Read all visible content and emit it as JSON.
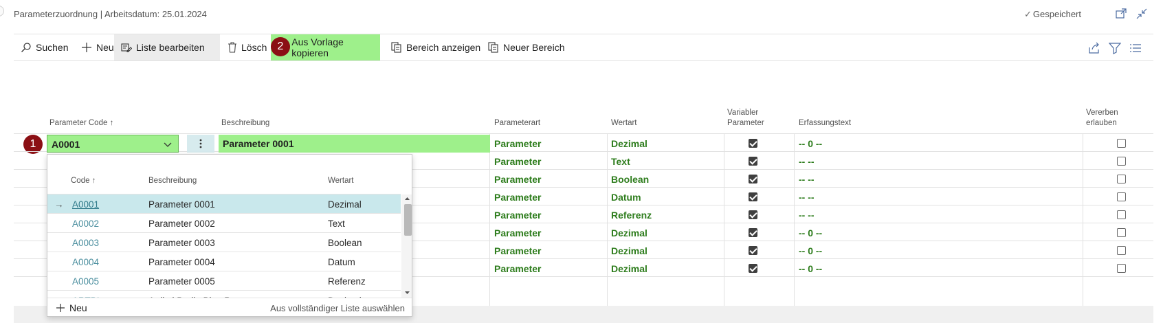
{
  "header": {
    "title": "Parameterzuordnung | Arbeitsdatum: 25.01.2024",
    "saved_status": "Gespeichert"
  },
  "actions": {
    "search": "Suchen",
    "new": "Neu",
    "edit_list": "Liste bearbeiten",
    "delete": "Lösch",
    "copy_template": "Aus Vorlage kopieren",
    "show_range": "Bereich anzeigen",
    "new_range": "Neuer Bereich"
  },
  "badges": {
    "one": "1",
    "two": "2"
  },
  "columns": {
    "code": "Parameter Code ↑",
    "description": "Beschreibung",
    "param_type": "Parameterart",
    "value_type": "Wertart",
    "variable_1": "Variabler",
    "variable_2": "Parameter",
    "entry_text": "Erfassungstext",
    "inherit_1": "Vererben",
    "inherit_2": "erlauben"
  },
  "rows": [
    {
      "code": "A0001",
      "description": "Parameter 0001",
      "param_type": "Parameter",
      "value_type": "Dezimal",
      "variable": true,
      "entry_text": "-- 0 --",
      "inherit": false
    },
    {
      "param_type": "Parameter",
      "value_type": "Text",
      "variable": true,
      "entry_text": "--  --",
      "inherit": false
    },
    {
      "param_type": "Parameter",
      "value_type": "Boolean",
      "variable": true,
      "entry_text": "--  --",
      "inherit": false
    },
    {
      "param_type": "Parameter",
      "value_type": "Datum",
      "variable": true,
      "entry_text": "--  --",
      "inherit": false
    },
    {
      "param_type": "Parameter",
      "value_type": "Referenz",
      "variable": true,
      "entry_text": "--  --",
      "inherit": false
    },
    {
      "param_type": "Parameter",
      "value_type": "Dezimal",
      "variable": true,
      "entry_text": "-- 0 --",
      "inherit": false
    },
    {
      "param_type": "Parameter",
      "value_type": "Dezimal",
      "variable": true,
      "entry_text": "-- 0 --",
      "inherit": false
    },
    {
      "param_type": "Parameter",
      "value_type": "Dezimal",
      "variable": true,
      "entry_text": "-- 0 --",
      "inherit": false
    }
  ],
  "dropdown": {
    "columns": {
      "code": "Code ↑",
      "description": "Beschreibung",
      "type": "Wertart"
    },
    "selected_arrow": "→",
    "items": [
      {
        "code": "A0001",
        "description": "Parameter 0001",
        "type": "Dezimal"
      },
      {
        "code": "A0002",
        "description": "Parameter 0002",
        "type": "Text"
      },
      {
        "code": "A0003",
        "description": "Parameter 0003",
        "type": "Boolean"
      },
      {
        "code": "A0004",
        "description": "Parameter 0004",
        "type": "Datum"
      },
      {
        "code": "A0005",
        "description": "Parameter 0005",
        "type": "Referenz"
      },
      {
        "code": "ARTBI",
        "description": "Artikel Bedin Blatt Parameter",
        "type": "Dezimal"
      }
    ],
    "footer_new": "Neu",
    "footer_full_list": "Aus vollständiger Liste auswählen"
  },
  "colors": {
    "highlight": "#9ef08b",
    "badge": "#8b0f14",
    "value_green": "#2e7d1d",
    "selected_row": "#c9e8ec"
  }
}
